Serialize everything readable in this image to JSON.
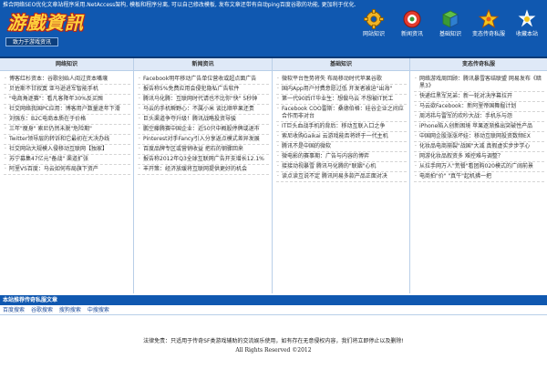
{
  "header": {
    "top_text": "推合网络SEO优化文章站程序采用.NetAccess架构, 模板和程序分离, 可以自己修改模板, 发布文章还带有自动ping百度谷歌的功能, 更加利于优化.",
    "logo": "游戲資訊",
    "slogan": "致力于游戏资讯"
  },
  "nav": [
    {
      "label": "网站知识",
      "icon": "gear-icon"
    },
    {
      "label": "新闻资讯",
      "icon": "news-icon"
    },
    {
      "label": "基础知识",
      "icon": "book-icon"
    },
    {
      "label": "变态传奇私服",
      "icon": "star-icon"
    },
    {
      "label": "收藏本站",
      "icon": "bookmark-icon"
    }
  ],
  "columns": [
    {
      "title": "网络知识",
      "items": [
        "博客红杉资本：谷歌创始人阅过资本嘴壤",
        "贝佐斯不甘寂寞 亚马逊进军智能手机",
        "\"电商角逐赛\"：看凡客降年30%反买囤",
        "社交网络我国PC应用：博客用户数量逐年下滑",
        "刘强东：B2C电商本质在于价格",
        "三年\"瘦身\" 索尼仍然未脱\"危险期\"",
        "Twitter领导层的转诉和它最初在大决办线",
        "社交网站大规模入侵移动互联网【独家】",
        "苏宁募集47亿元\"备战\" 渠道扩张",
        "阿里VS百度：马云如何布局旗下资产"
      ]
    },
    {
      "title": "新闻资讯",
      "items": [
        "Facebook明年移动广告单位营收或超点面广告",
        "报告称5%免费应用会侵犯隐私广告软件",
        "腾讯马化腾：互联网时代请也不比你\"快\" 5秒钟",
        "马云的手机瞬野心：不属小米 谈比顺苹果还贵",
        "巨头渠道争夺升级！腾讯战略投资导骏",
        "鹏空藤腾赛中国企业：近50只中概股停牌或退市",
        "Pinterest对手Fancy引入分享返点模式差异发展",
        "百度品牌专区或营销收益 把石的钢骤回来",
        "报告称2012年Q3全球互联网广告开支增长12.1%",
        "丰开策：经济放缓将互联网提供更好的机会"
      ]
    },
    {
      "title": "基础知识",
      "items": [
        "微软平台性势将失 布局移动时代苹果谷歌",
        "国内App用户付费意愿过低 开发者被迫\"出海\"",
        "第一代90后IT毕业生：想做马云 不想被IT民工",
        "Facebook COO雷斯：桑德伯格：硅谷企业之间应合作而非对台",
        "IT巨头血战手机的背后：移动互联入口之争",
        "索尼收购Gaikai 云游戏能否将终于一代主机",
        "腾讯不是中国的微软",
        "微电影的赛事期：广告与内容的博弈",
        "接接动视暴雪 腾讯马化腾的\"联姻\"心机",
        "读点读互说不定 腾讯同易多款产品正面对决"
      ]
    },
    {
      "title": "变态传奇私服",
      "items": [
        "网络游戏周回顾：腾讯暴雪客结联盟 网易发布《暗黑3》",
        "快递红黑军兄弟：新一轮对决序幕拉开",
        "马云欲Facebook：新阿里帝国舞掘计划",
        "周鸿祎与雷军的欢吵大战：手机乐与怨",
        "iPhone陷入创新困境 苹果逐渐推出突破性产品",
        "中国网企股涨涨坏娃：移动互联网投资数频EX",
        "化妆品电商崩裂\"战国\"大减 真假虚实步步学心",
        "网游化妆品叙资多 难控难与调整？",
        "从拉手网万人\"荒餐\"看团购020模式的广阔前景",
        "电商拍\"价\" \"真牛\"起机拂一把"
      ]
    }
  ],
  "recommend": {
    "title": "本站推荐传奇私服文章",
    "links": [
      "百度搜索",
      "谷歌搜索",
      "搜狗搜索",
      "中搜搜索"
    ]
  },
  "footer": {
    "disclaimer": "法律免责：只适用于传奇SF类游戏辅助的交流娱乐使用，如有存在无意侵权内容，我们将立即停止以及删除!",
    "copyright": "All Rights Reserved ©2012"
  },
  "colors": {
    "header_bg": "#1058b0",
    "logo_text": "#ffd23c",
    "column_head_bg": "#dfe9f7",
    "link": "#1a4a9a"
  }
}
